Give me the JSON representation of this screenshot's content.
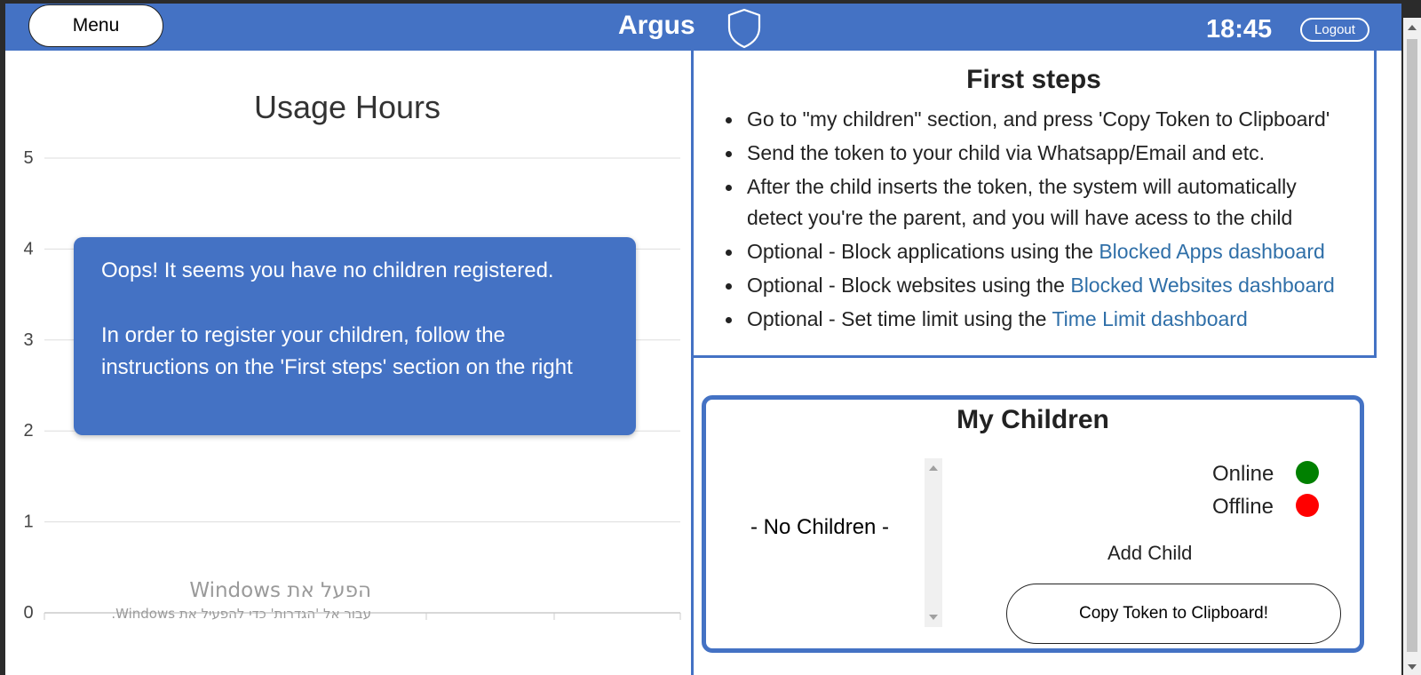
{
  "header": {
    "menu_label": "Menu",
    "app_title": "Argus",
    "logo_icon": "shield-icon",
    "clock": "18:45",
    "logout_label": "Logout",
    "accent_color": "#4472c4"
  },
  "chart_data": {
    "type": "bar",
    "title": "Usage Hours",
    "categories": [],
    "values": [],
    "xlabel": "",
    "ylabel": "",
    "ylim": [
      0,
      5
    ],
    "y_ticks": [
      "5",
      "4",
      "3",
      "2",
      "1",
      "0"
    ],
    "grid": true,
    "legend": "none"
  },
  "empty_state": {
    "line1": "Oops! It seems you have no children registered.",
    "line2": "In order to register your children, follow the instructions on the 'First steps' section on the right"
  },
  "watermark": {
    "title": "הפעל את Windows",
    "subtitle": "עבור אל 'הגדרות' כדי להפעיל את Windows."
  },
  "first_steps": {
    "title": "First steps",
    "steps": [
      {
        "text": "Go to \"my children\" section, and press 'Copy Token to Clipboard'",
        "link": ""
      },
      {
        "text": "Send the token to your child via Whatsapp/Email and etc.",
        "link": ""
      },
      {
        "text": "After the child inserts the token, the system will automatically",
        "text2": "detect you're the parent, and you will have acess to the child",
        "link": ""
      },
      {
        "text": "Optional - Block applications using the ",
        "link": "Blocked Apps dashboard"
      },
      {
        "text": "Optional - Block websites using the ",
        "link": "Blocked Websites dashboard"
      },
      {
        "text": "Optional - Set time limit using the ",
        "link": "Time Limit dashboard"
      }
    ],
    "link_color": "#2f6fa8"
  },
  "my_children": {
    "title": "My Children",
    "empty_label": "- No Children -",
    "online_label": "Online",
    "offline_label": "Offline",
    "online_color": "#008000",
    "offline_color": "#ff0000",
    "add_child_label": "Add Child",
    "copy_token_label": "Copy Token to Clipboard!"
  }
}
